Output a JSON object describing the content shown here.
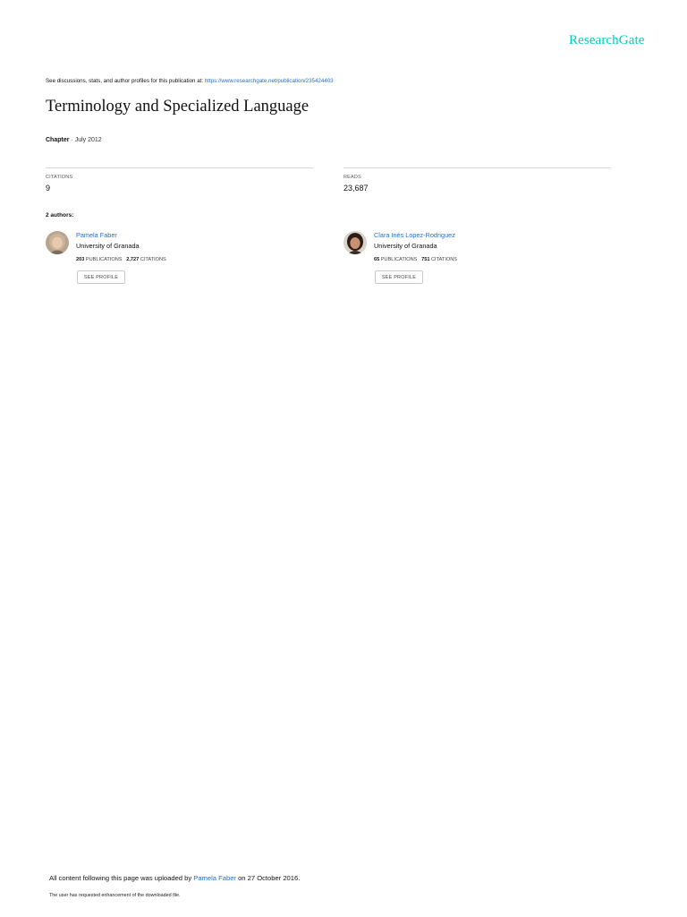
{
  "brand": {
    "logo_text": "ResearchGate",
    "accent_color": "#00ccbb",
    "link_color": "#2a6ec1"
  },
  "header": {
    "discussion_prefix": "See discussions, stats, and author profiles for this publication at: ",
    "discussion_url": "https://www.researchgate.net/publication/235424403"
  },
  "publication": {
    "title": "Terminology and Specialized Language",
    "type": "Chapter",
    "separator": " · ",
    "date": "July 2012"
  },
  "stats": {
    "citations_label": "CITATIONS",
    "citations_value": "9",
    "reads_label": "READS",
    "reads_value": "23,687"
  },
  "authors_heading": "2 authors:",
  "authors": [
    {
      "name": "Pamela Faber",
      "institution": "University of Granada",
      "publications_count": "203",
      "publications_label": "PUBLICATIONS",
      "citations_count": "2,727",
      "citations_label": "CITATIONS",
      "button_label": "SEE PROFILE"
    },
    {
      "name": "Clara Inés Lopez-Rodriguez",
      "institution": "University of Granada",
      "publications_count": "65",
      "publications_label": "PUBLICATIONS",
      "citations_count": "751",
      "citations_label": "CITATIONS",
      "button_label": "SEE PROFILE"
    }
  ],
  "footer": {
    "upload_prefix": "All content following this page was uploaded by ",
    "uploader_name": "Pamela Faber",
    "upload_suffix": " on 27 October 2016.",
    "enhancement_note": "The user has requested enhancement of the downloaded file."
  }
}
